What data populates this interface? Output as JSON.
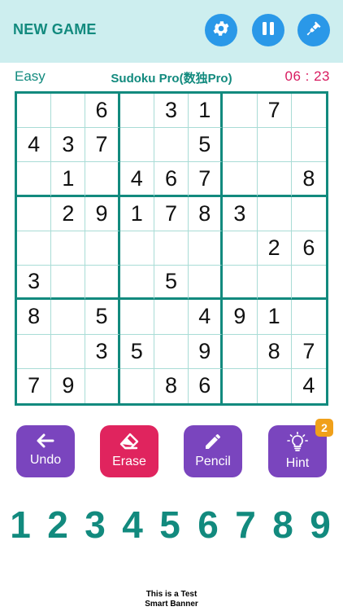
{
  "header": {
    "new_game_label": "NEW GAME",
    "settings_icon": "gear-icon",
    "pause_icon": "pause-icon",
    "theme_icon": "paint-brush-icon",
    "accent": "#2a98e8",
    "background": "#cdeeef"
  },
  "status": {
    "difficulty": "Easy",
    "title": "Sudoku Pro(数独Pro)",
    "timer": "06 : 23"
  },
  "board": {
    "grid": [
      [
        "",
        "",
        "6",
        "",
        "3",
        "1",
        "",
        "7",
        ""
      ],
      [
        "4",
        "3",
        "7",
        "",
        "",
        "5",
        "",
        "",
        ""
      ],
      [
        "",
        "1",
        "",
        "4",
        "6",
        "7",
        "",
        "",
        "8"
      ],
      [
        "",
        "2",
        "9",
        "1",
        "7",
        "8",
        "3",
        "",
        ""
      ],
      [
        "",
        "",
        "",
        "",
        "",
        "",
        "",
        "2",
        "6"
      ],
      [
        "3",
        "",
        "",
        "",
        "5",
        "",
        "",
        "",
        ""
      ],
      [
        "8",
        "",
        "5",
        "",
        "",
        "4",
        "9",
        "1",
        ""
      ],
      [
        "",
        "",
        "3",
        "5",
        "",
        "9",
        "",
        "8",
        "7"
      ],
      [
        "7",
        "9",
        "",
        "",
        "8",
        "6",
        "",
        "",
        "4"
      ]
    ],
    "line_color": "#128a7e",
    "thin_line_color": "#a9dcd6"
  },
  "tools": {
    "undo": {
      "label": "Undo",
      "icon": "arrow-left-icon",
      "color": "#7a45be"
    },
    "erase": {
      "label": "Erase",
      "icon": "eraser-icon",
      "color": "#e0245e"
    },
    "pencil": {
      "label": "Pencil",
      "icon": "pencil-icon",
      "color": "#7a45be"
    },
    "hint": {
      "label": "Hint",
      "icon": "lightbulb-icon",
      "color": "#7a45be",
      "badge": "2"
    }
  },
  "numpad": [
    "1",
    "2",
    "3",
    "4",
    "5",
    "6",
    "7",
    "8",
    "9"
  ],
  "banner": {
    "line1": "This is a Test",
    "line2": "Smart Banner"
  }
}
